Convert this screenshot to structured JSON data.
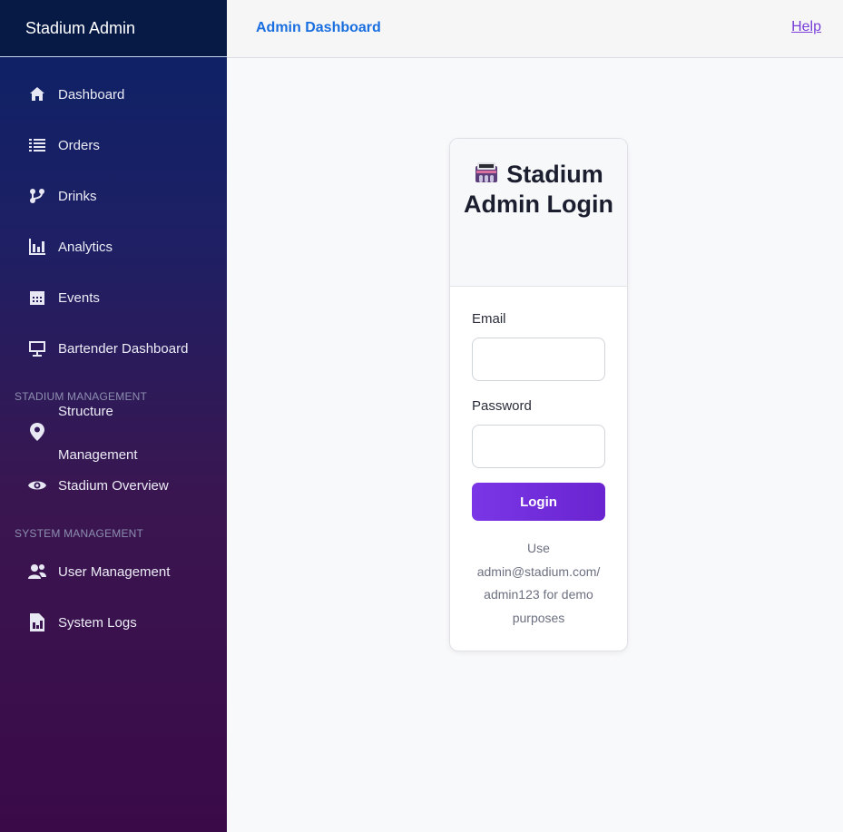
{
  "sidebar": {
    "brand": "Stadium Admin",
    "items": [
      {
        "label": "Dashboard",
        "icon": "home-icon"
      },
      {
        "label": "Orders",
        "icon": "list-icon"
      },
      {
        "label": "Drinks",
        "icon": "branch-icon"
      },
      {
        "label": "Analytics",
        "icon": "bar-chart-icon"
      },
      {
        "label": "Events",
        "icon": "calendar-icon"
      },
      {
        "label": "Bartender Dashboard",
        "icon": "monitor-icon"
      }
    ],
    "section_stadium": "STADIUM MANAGEMENT",
    "stadium_items": [
      {
        "label": "Structure Management",
        "icon": "map-pin-icon"
      },
      {
        "label": "Stadium Overview",
        "icon": "eye-icon"
      }
    ],
    "section_system": "SYSTEM MANAGEMENT",
    "system_items": [
      {
        "label": "User Management",
        "icon": "users-icon"
      },
      {
        "label": "System Logs",
        "icon": "file-chart-icon"
      }
    ]
  },
  "topbar": {
    "title": "Admin Dashboard",
    "help": "Help"
  },
  "login": {
    "title": "Stadium Admin Login",
    "email_label": "Email",
    "email_value": "",
    "password_label": "Password",
    "password_value": "",
    "button": "Login",
    "hint": "Use admin@stadium.com/ admin123 for demo purposes"
  },
  "colors": {
    "accent": "#7a36e6",
    "link": "#1a6fe0",
    "help_link": "#7a3fd8",
    "sidebar_top": "#0b2266",
    "sidebar_bottom": "#3a0a48"
  }
}
